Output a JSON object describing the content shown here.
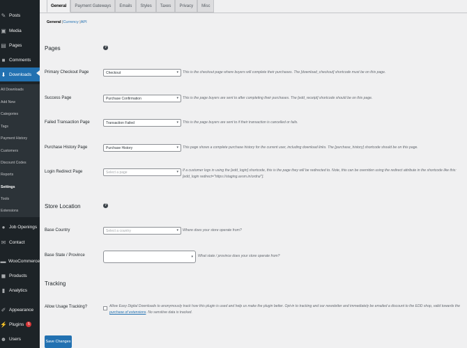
{
  "sidebar": {
    "items": [
      {
        "label": "Posts",
        "icon": "pin-icon"
      },
      {
        "label": "Media",
        "icon": "media-icon"
      },
      {
        "label": "Pages",
        "icon": "page-icon"
      },
      {
        "label": "Comments",
        "icon": "comment-icon"
      },
      {
        "label": "Downloads",
        "icon": "download-icon"
      },
      {
        "label": "Job Openings",
        "icon": "people-icon"
      },
      {
        "label": "Contact",
        "icon": "mail-icon"
      },
      {
        "label": "WooCommerce",
        "icon": "woo-icon"
      },
      {
        "label": "Products",
        "icon": "box-icon"
      },
      {
        "label": "Analytics",
        "icon": "bar-chart-icon"
      },
      {
        "label": "Appearance",
        "icon": "brush-icon"
      },
      {
        "label": "Plugins",
        "icon": "plug-icon",
        "badge": "5"
      },
      {
        "label": "Users",
        "icon": "user-icon"
      }
    ],
    "submenu": [
      "All Downloads",
      "Add New",
      "Categories",
      "Tags",
      "Payment History",
      "Customers",
      "Discount Codes",
      "Reports",
      "Settings",
      "Tools",
      "Extensions"
    ]
  },
  "tabs": [
    "General",
    "Payment Gateways",
    "Emails",
    "Styles",
    "Taxes",
    "Privacy",
    "Misc"
  ],
  "subnav": {
    "current": "General",
    "links": [
      "Currency",
      "API"
    ],
    "sep": "|"
  },
  "sections": {
    "pages": "Pages",
    "store_location": "Store Location",
    "tracking": "Tracking"
  },
  "help_glyph": "?",
  "fields": {
    "primary_checkout": {
      "label": "Primary Checkout Page",
      "value": "Checkout",
      "desc": "This is the checkout page where buyers will complete their purchases. The [download_checkout] shortcode must be on this page."
    },
    "success": {
      "label": "Success Page",
      "value": "Purchase Confirmation",
      "desc": "This is the page buyers are sent to after completing their purchases. The [edd_receipt] shortcode should be on this page."
    },
    "failed": {
      "label": "Failed Transaction Page",
      "value": "Transaction Failed",
      "desc": "This is the page buyers are sent to if their transaction is cancelled or fails."
    },
    "history": {
      "label": "Purchase History Page",
      "value": "Purchase History",
      "desc": "This page shows a complete purchase history for the current user, including download links. The [purchase_history] shortcode should be on this page."
    },
    "login_redirect": {
      "label": "Login Redirect Page",
      "placeholder": "Select a page",
      "desc": "If a customer logs in using the [edd_login] shortcode, this is the page they will be redirected to. Note, this can be overriden using the redirect attribute in the shortcode like this: [edd_login redirect=\"https://staging.avsm.in/ordra/\"]."
    },
    "base_country": {
      "label": "Base Country",
      "placeholder": "Select a country",
      "desc": "Where does your store operate from?"
    },
    "base_state": {
      "label": "Base State / Province",
      "value": "",
      "desc": "What state / province does your store operate from?"
    },
    "usage_tracking": {
      "label": "Allow Usage Tracking?",
      "desc_before": "Allow Easy Digital Downloads to anonymously track how this plugin is used and help us make the plugin better. Opt-in to tracking and our newsletter and immediately be emailed a discount to the EDD shop, valid towards the ",
      "link": "purchase of extensions",
      "desc_after": ". No sensitive data is tracked."
    }
  },
  "save_button": "Save Changes",
  "select_arrow": "▾",
  "colors": {
    "sidebar": "#1d2327",
    "accent": "#2271b1",
    "submenu": "#2c3338"
  }
}
